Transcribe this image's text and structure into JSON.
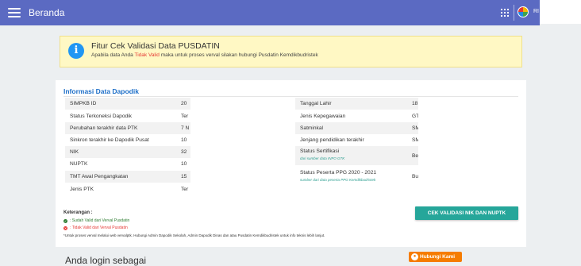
{
  "topbar": {
    "title": "Beranda",
    "username": "RI"
  },
  "banner": {
    "title": "Fitur Cek Validasi Data PUSDATIN",
    "desc_prefix": "Apabila data Anda",
    "desc_highlight": "Tidak Valid",
    "desc_suffix": "maka untuk proses verval silakan hubungi Pusdatin Kemdikbudristek"
  },
  "card": {
    "title": "Informasi Data Dapodik",
    "left_rows": [
      {
        "label": "SIMPKB ID",
        "value": "20"
      },
      {
        "label": "Status Terkoneksi Dapodik",
        "value": "Ter"
      },
      {
        "label": "Perubahan terakhir data PTK",
        "value": "7 N"
      },
      {
        "label": "Sinkron terakhir ke Dapodik Pusat",
        "value": "10"
      },
      {
        "label": "NIK",
        "value": "32"
      },
      {
        "label": "NUPTK",
        "value": "10"
      },
      {
        "label": "TMT Awal Pengangkatan",
        "value": "15"
      },
      {
        "label": "Jenis PTK",
        "value": "Ter"
      }
    ],
    "right_rows": [
      {
        "label": "Tanggal Lahir",
        "value": "18"
      },
      {
        "label": "Jenis Kepegawaian",
        "value": "GT"
      },
      {
        "label": "Satminkal",
        "value": "SM"
      },
      {
        "label": "Jenjang pendidikan terakhir",
        "value": "SM"
      },
      {
        "label": "Status Sertifikasi",
        "value": "Be",
        "sub": "dari sumber data INFO GTK"
      },
      {
        "label": "Status Peserta PPG 2020 - 2021",
        "value": "Bu",
        "sub": "sumber dari data peserta PPG Kemdikbudristek"
      }
    ],
    "keterangan": {
      "title": "Keterangan :",
      "valid": ": Sudah Valid dari Verval Pusdatin",
      "invalid": ": Tidak Valid dari Verval Pusdatin",
      "note": "*Untuk proses verval melalui web vervalptk. Hubungi Admin Dapodik Sekolah, Admin Dapodik Dinas dan atau Pusdatin Kemdikbudristek untuk info teknis lebih lanjut."
    },
    "check_button": "CEK VALIDASI NIK DAN NUPTK"
  },
  "footer": {
    "anda_text": "Anda login sebagai",
    "contact_button": "Hubungi Kami"
  },
  "colors": {
    "topbar": "#5b6ac2",
    "banner_bg": "#fff8c4",
    "info_icon": "#2196f3",
    "card_title": "#1e6fc8",
    "check_button": "#26a69a",
    "contact_button": "#f57c00",
    "valid": "#2e7d32",
    "invalid": "#e53935"
  },
  "icons": {
    "menu": "hamburger-menu-icon",
    "apps": "apps-grid-icon",
    "avatar": "user-avatar",
    "info": "info-icon",
    "valid": "check-circle-icon",
    "invalid": "x-circle-icon",
    "contact": "chat-icon"
  }
}
